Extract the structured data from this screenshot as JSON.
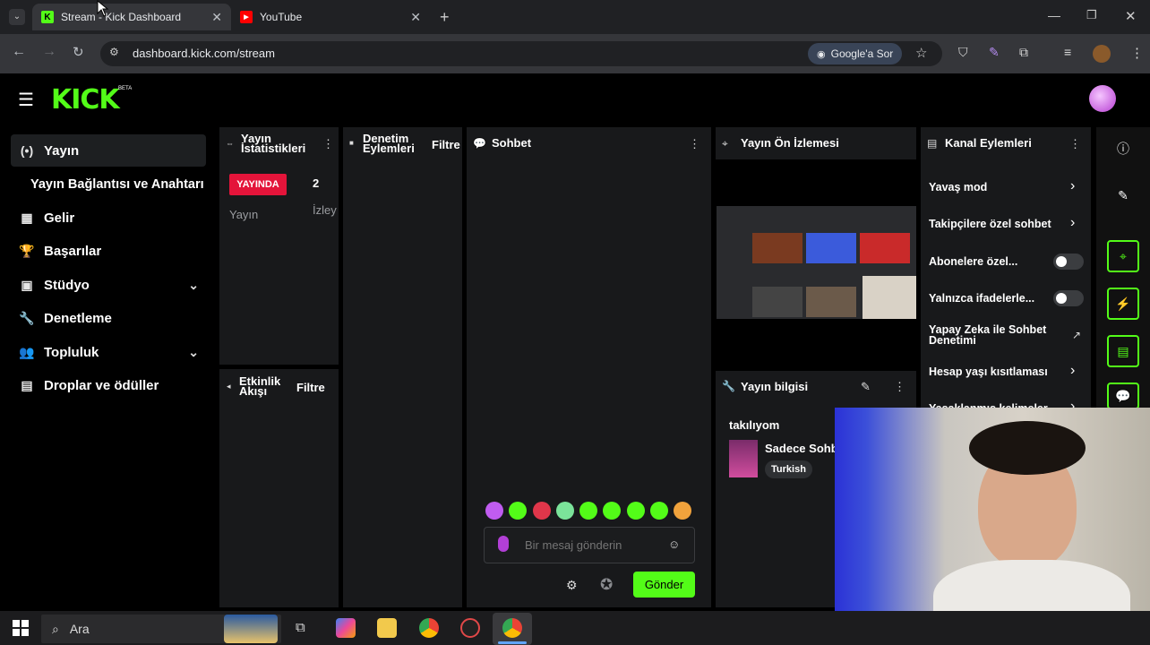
{
  "browser": {
    "tabs": [
      {
        "title": "Stream - Kick Dashboard",
        "active": true
      },
      {
        "title": "YouTube",
        "active": false
      }
    ],
    "url": "dashboard.kick.com/stream",
    "google_button": "Google'a Sor"
  },
  "header": {
    "logo": "KICK",
    "beta": "BETA"
  },
  "sidebar": {
    "items": [
      {
        "label": "Yayın",
        "icon": "broadcast-icon"
      },
      {
        "label": "Yayın Bağlantısı ve Anahtarı",
        "icon": ""
      },
      {
        "label": "Gelir",
        "icon": "dashboard-icon"
      },
      {
        "label": "Başarılar",
        "icon": "trophy-icon"
      },
      {
        "label": "Stüdyo",
        "icon": "studio-icon"
      },
      {
        "label": "Denetleme",
        "icon": "wrench-icon"
      },
      {
        "label": "Topluluk",
        "icon": "community-icon"
      },
      {
        "label": "Droplar ve ödüller",
        "icon": "drops-icon"
      }
    ]
  },
  "stats": {
    "title_line1": "Yayın",
    "title_line2": "İstatistikleri",
    "status": "YAYINDA",
    "status_label": "Yayın",
    "viewer_count": "2",
    "viewer_label": "İzley"
  },
  "moderation": {
    "title_line1": "Denetim",
    "title_line2": "Eylemleri",
    "filter": "Filtre"
  },
  "activity": {
    "title_line1": "Etkinlik",
    "title_line2": "Akışı",
    "filter": "Filtre"
  },
  "chat": {
    "title": "Sohbet",
    "placeholder": "Bir mesaj gönderin",
    "send": "Gönder"
  },
  "preview": {
    "title": "Yayın Ön İzlemesi"
  },
  "stream_info": {
    "title": "Yayın bilgisi",
    "stream_title": "takılıyom",
    "category": "Sadece Sohb",
    "language": "Turkish"
  },
  "channel_actions": {
    "title": "Kanal Eylemleri",
    "items": [
      {
        "label": "Yavaş mod",
        "control": "arrow"
      },
      {
        "label": "Takipçilere özel sohbet",
        "control": "arrow"
      },
      {
        "label": "Abonelere özel...",
        "control": "toggle"
      },
      {
        "label": "Yalnızca ifadelerle...",
        "control": "toggle"
      },
      {
        "label_line1": "Yapay Zeka ile Sohbet",
        "label_line2": "Denetimi",
        "control": "external"
      },
      {
        "label": "Hesap yaşı kısıtlaması",
        "control": "arrow"
      },
      {
        "label": "Yasaklanmış kelimeler",
        "control": "arrow"
      }
    ]
  },
  "taskbar": {
    "search": "Ara"
  },
  "colors": {
    "kick_green": "#53fc18",
    "live_red": "#e4143a",
    "panel": "#18191b"
  }
}
